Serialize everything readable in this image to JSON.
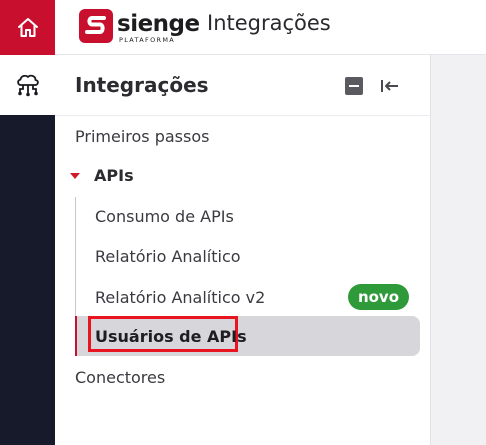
{
  "header": {
    "brand": "sienge",
    "brand_sub": "PLATAFORMA",
    "title": "Integrações"
  },
  "rail": {
    "items": [
      {
        "icon": "home-icon",
        "active": true
      },
      {
        "icon": "cloud-network-icon",
        "active": false
      }
    ]
  },
  "panel": {
    "title": "Integrações",
    "nav": {
      "primeiros_passos": "Primeiros passos",
      "apis": "APIs",
      "apis_children": {
        "consumo": "Consumo de APIs",
        "relatorio": "Relatório Analítico",
        "relatorio_v2": "Relatório Analítico v2",
        "relatorio_v2_badge": "novo",
        "usuarios": "Usuários de APIs"
      },
      "conectores": "Conectores"
    }
  },
  "colors": {
    "brand_red": "#c8102e",
    "rail_dark": "#161a2b",
    "badge_green": "#2f9a3a",
    "highlight_red": "#e8141f"
  }
}
